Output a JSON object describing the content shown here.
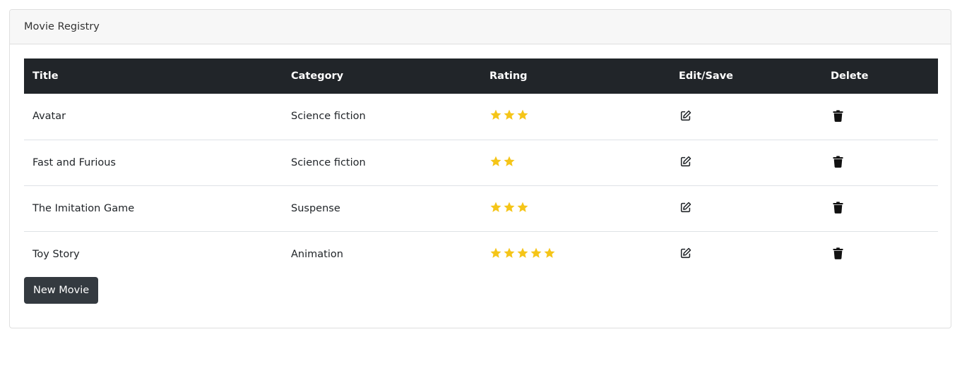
{
  "card": {
    "title": "Movie Registry"
  },
  "table": {
    "headers": {
      "title": "Title",
      "category": "Category",
      "rating": "Rating",
      "edit": "Edit/Save",
      "delete": "Delete"
    },
    "rows": [
      {
        "title": "Avatar",
        "category": "Science fiction",
        "rating": 3
      },
      {
        "title": "Fast and Furious",
        "category": "Science fiction",
        "rating": 2
      },
      {
        "title": "The Imitation Game",
        "category": "Suspense",
        "rating": 3
      },
      {
        "title": "Toy Story",
        "category": "Animation",
        "rating": 5
      }
    ]
  },
  "actions": {
    "new_movie_label": "New Movie"
  },
  "icons": {
    "rating": "star-icon",
    "edit": "edit-icon",
    "delete": "trash-icon"
  },
  "colors": {
    "header_bg": "#212529",
    "star": "#f5c518",
    "button_bg": "#343a40"
  }
}
